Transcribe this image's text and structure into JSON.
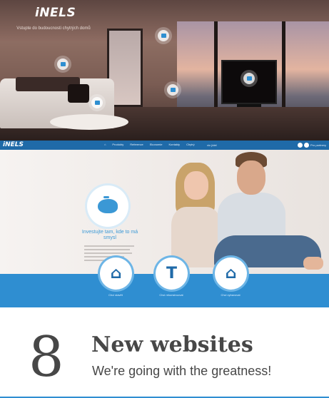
{
  "hero": {
    "logo_text": "iNELS",
    "tagline": "Vstupte do budoucnosti chytrých domů",
    "hotspots": [
      "monitor-icon",
      "light-icon",
      "speaker-icon",
      "remote-icon",
      "tv-icon"
    ]
  },
  "site": {
    "nav": {
      "logo": "iNELS",
      "links": [
        "Produkty",
        "Reference",
        "Ekonomie",
        "Kontakty",
        "Chytrý"
      ],
      "extra": "víc jídel",
      "account": "Pro partnery"
    },
    "invest_text": "Investujte tam, kde to má smysl",
    "services": [
      {
        "label": "Chci stavět",
        "icon": "house-icon",
        "glyph": "⌂"
      },
      {
        "label": "Chci rekonstruovat",
        "icon": "tool-icon",
        "glyph": "T"
      },
      {
        "label": "Chci vybavovat",
        "icon": "house-icon",
        "glyph": "⌂"
      }
    ]
  },
  "caption": {
    "number": "8",
    "title": "New websites",
    "subtitle": "We're going with the greatness!"
  },
  "colors": {
    "brand_blue": "#2f8ed1",
    "nav_blue": "#1f6aa8",
    "text_gray": "#474747"
  }
}
